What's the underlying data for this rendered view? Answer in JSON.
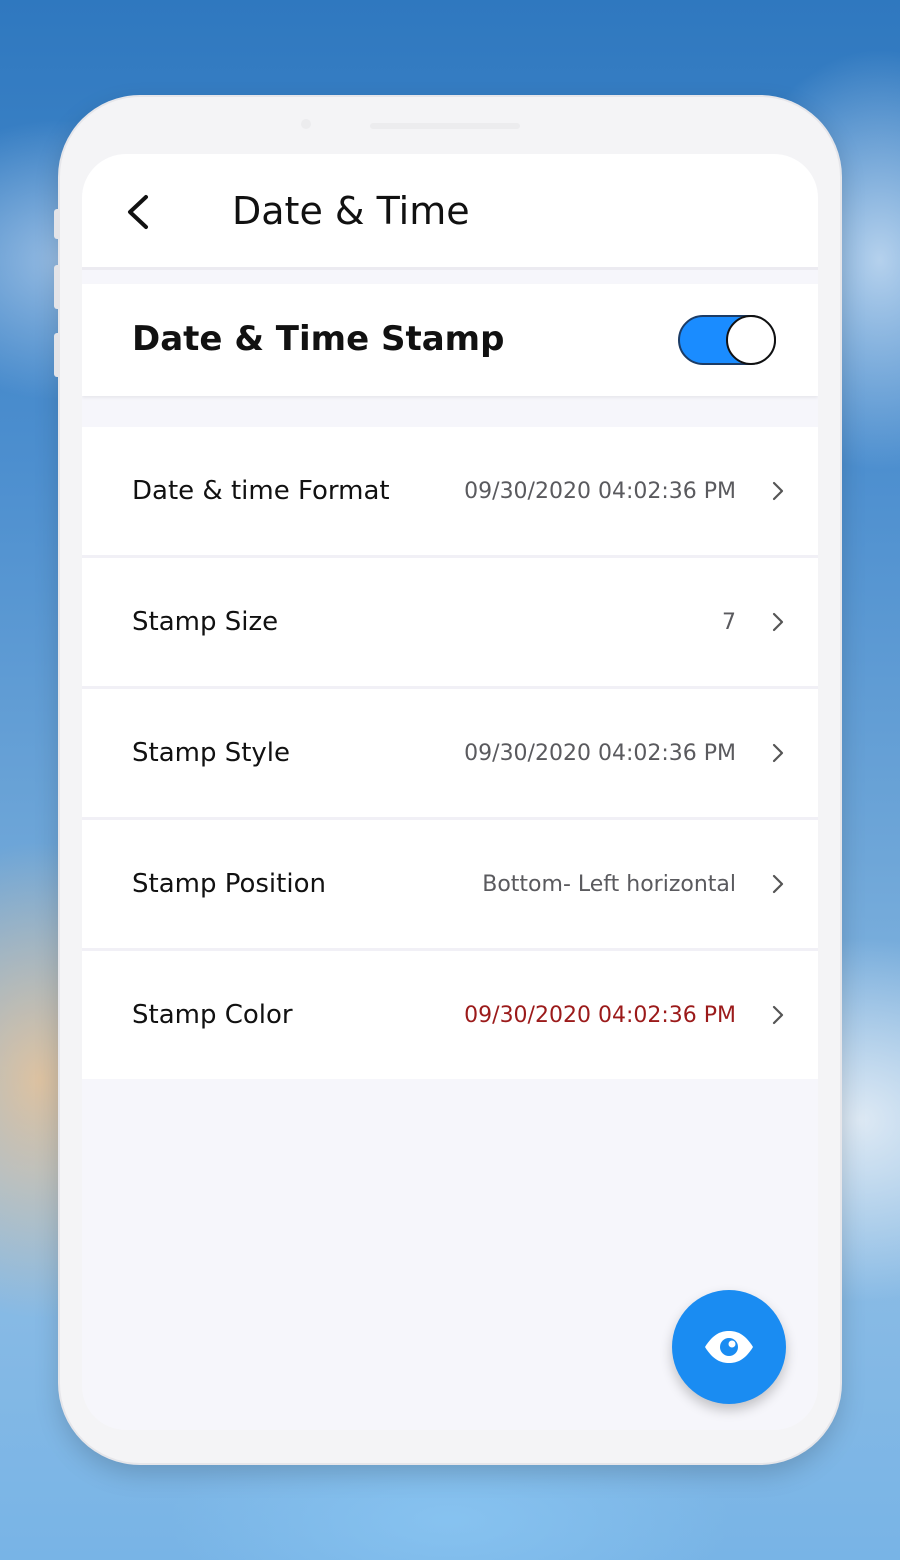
{
  "header": {
    "title": "Date & Time",
    "back_icon": "chevron-left-icon"
  },
  "stamp_toggle": {
    "label": "Date & Time Stamp",
    "enabled": true,
    "accent_color": "#1a8cff"
  },
  "settings": [
    {
      "label": "Date & time Format",
      "value": "09/30/2020 04:02:36 PM",
      "value_color": "#5a5a5e"
    },
    {
      "label": "Stamp Size",
      "value": "7",
      "value_color": "#5a5a5e"
    },
    {
      "label": "Stamp Style",
      "value": "09/30/2020 04:02:36 PM",
      "value_color": "#5a5a5e"
    },
    {
      "label": "Stamp Position",
      "value": "Bottom- Left horizontal",
      "value_color": "#5a5a5e"
    },
    {
      "label": "Stamp Color",
      "value": "09/30/2020 04:02:36 PM",
      "value_color": "#9b1a1a"
    }
  ],
  "fab": {
    "icon": "eye-icon",
    "color": "#1a8cf2"
  }
}
